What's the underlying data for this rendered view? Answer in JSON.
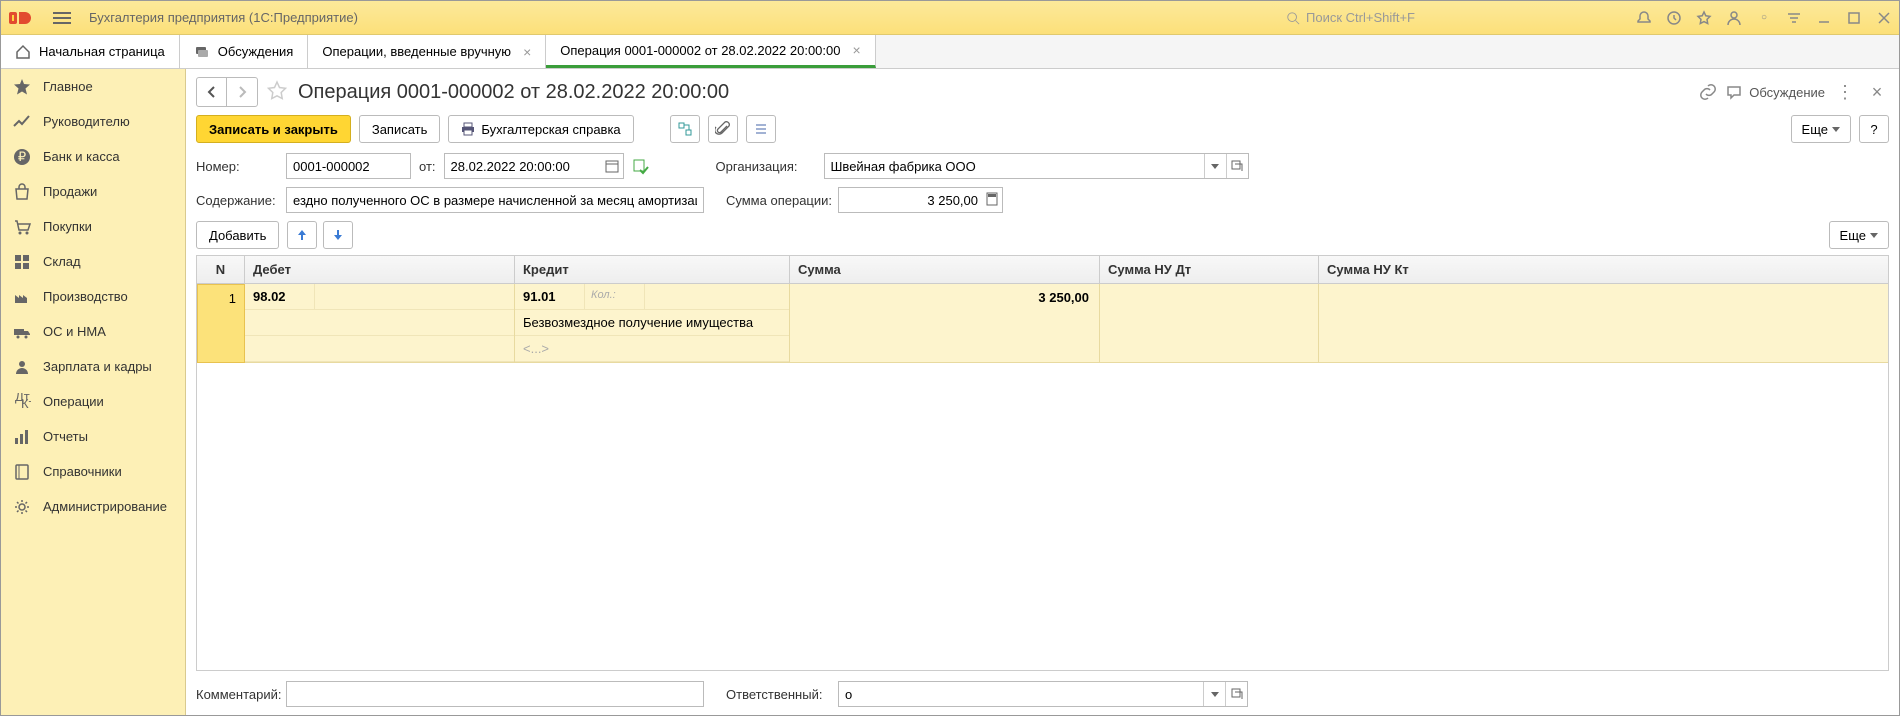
{
  "app_title": "Бухгалтерия предприятия  (1С:Предприятие)",
  "search_placeholder": "Поиск Ctrl+Shift+F",
  "tabs": {
    "home": "Начальная страница",
    "discuss": "Обсуждения",
    "ops": "Операции, введенные вручную",
    "current": "Операция 0001-000002 от 28.02.2022 20:00:00"
  },
  "sidebar": [
    "Главное",
    "Руководителю",
    "Банк и касса",
    "Продажи",
    "Покупки",
    "Склад",
    "Производство",
    "ОС и НМА",
    "Зарплата и кадры",
    "Операции",
    "Отчеты",
    "Справочники",
    "Администрирование"
  ],
  "doc": {
    "title": "Операция 0001-000002 от 28.02.2022 20:00:00",
    "discuss": "Обсуждение"
  },
  "toolbar": {
    "save_close": "Записать и закрыть",
    "save": "Записать",
    "ref": "Бухгалтерская справка",
    "more": "Еще",
    "help": "?",
    "add": "Добавить"
  },
  "labels": {
    "number": "Номер:",
    "from": "от:",
    "org": "Организация:",
    "content": "Содержание:",
    "sum": "Сумма операции:",
    "comment": "Комментарий:",
    "resp": "Ответственный:"
  },
  "fields": {
    "number": "0001-000002",
    "date": "28.02.2022 20:00:00",
    "org": "Швейная фабрика ООО",
    "content": "ездно полученного ОС в размере начисленной за месяц амортизации",
    "sum": "3 250,00",
    "comment": "",
    "resp": "о"
  },
  "grid": {
    "headers": {
      "n": "N",
      "debit": "Дебет",
      "credit": "Кредит",
      "sum": "Сумма",
      "nu1": "Сумма НУ Дт",
      "nu2": "Сумма НУ Кт"
    },
    "rows": [
      {
        "n": "1",
        "debit_acc": "98.02",
        "credit_acc": "91.01",
        "kol": "Кол.:",
        "desc1": "Безвозмездное получение имущества",
        "desc2": "<...>",
        "sum": "3 250,00"
      }
    ]
  }
}
